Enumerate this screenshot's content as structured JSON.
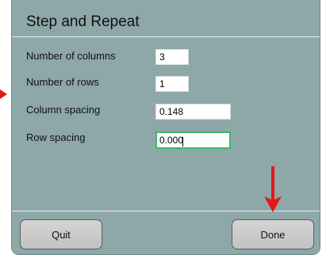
{
  "dialog": {
    "title": "Step and Repeat"
  },
  "fields": [
    {
      "label": "Number of columns",
      "value": "3"
    },
    {
      "label": "Number of rows",
      "value": "1"
    },
    {
      "label": "Column spacing",
      "value": "0.148"
    },
    {
      "label": "Row spacing",
      "value": "0.000"
    }
  ],
  "buttons": {
    "quit_label": "Quit",
    "done_label": "Done"
  },
  "colors": {
    "dialog_background": "#8ea7a8",
    "focus_border": "#3db86b",
    "annotation_arrow": "#e01818"
  }
}
